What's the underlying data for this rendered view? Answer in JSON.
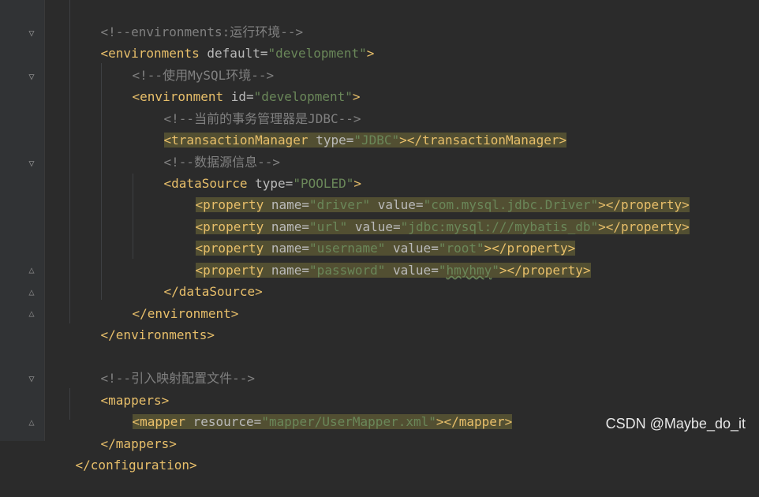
{
  "editor": {
    "lines": [
      {
        "comment": "<!--environments:运行环境-->"
      },
      {
        "open_tag": "<environments",
        "attr": "default",
        "value": "\"development\"",
        "close": ">"
      },
      {
        "comment": "<!--使用MySQL环境-->"
      },
      {
        "open_tag": "<environment",
        "attr": "id",
        "value": "\"development\"",
        "close": ">"
      },
      {
        "comment": "<!--当前的事务管理器是JDBC-->"
      },
      {
        "open_tag": "<transactionManager",
        "attr": "type",
        "value": "\"JDBC\"",
        "close": "></transactionManager>"
      },
      {
        "comment": "<!--数据源信息-->"
      },
      {
        "open_tag": "<dataSource",
        "attr": "type",
        "value": "\"POOLED\"",
        "close": ">"
      },
      {
        "open_tag": "<property",
        "attr": "name",
        "value": "\"driver\"",
        "attr2": "value",
        "value2": "\"com.mysql.jdbc.Driver\"",
        "close": "></property>"
      },
      {
        "open_tag": "<property",
        "attr": "name",
        "value": "\"url\"",
        "attr2": "value",
        "value2": "\"jdbc:mysql:///mybatis_db\"",
        "close": "></property>"
      },
      {
        "open_tag": "<property",
        "attr": "name",
        "value": "\"username\"",
        "attr2": "value",
        "value2": "\"root\"",
        "close": "></property>"
      },
      {
        "open_tag": "<property",
        "attr": "name",
        "value": "\"password\"",
        "attr2": "value",
        "value2_q": "\"",
        "value2_text": "hmyhmy",
        "close": "></property>"
      },
      {
        "tag": "</dataSource>"
      },
      {
        "tag": "</environment>"
      },
      {
        "tag": "</environments>"
      },
      {
        "comment": "<!--引入映射配置文件-->"
      },
      {
        "tag": "<mappers>"
      },
      {
        "open_tag": "<mapper",
        "attr": "resource",
        "value": "\"mapper/UserMapper.xml\"",
        "close": "></mapper>"
      },
      {
        "tag": "</mappers>"
      },
      {
        "tag": "</configuration>"
      }
    ]
  },
  "fold_icon": "fold-marker-icon",
  "watermark": "CSDN @Maybe_do_it"
}
